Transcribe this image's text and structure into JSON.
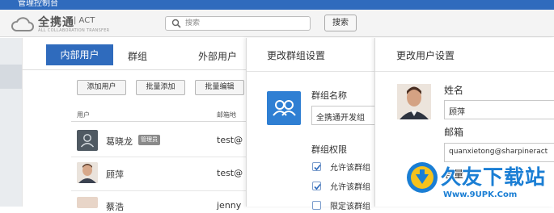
{
  "app": {
    "title": "管理控制台"
  },
  "logo": {
    "main": "全携通",
    "suffix": "| ACT",
    "tagline": "ALL COLLABORATION TRANSFER"
  },
  "search": {
    "placeholder": "搜索",
    "button": "搜索"
  },
  "users_panel": {
    "tabs": [
      {
        "label": "内部用户",
        "active": true
      },
      {
        "label": "群组"
      },
      {
        "label": "外部用户"
      }
    ],
    "toolbar": {
      "add_user": "添加用户",
      "batch_add": "批量添加",
      "batch_edit": "批量编辑"
    },
    "columns": {
      "user": "用户",
      "email": "邮箱地"
    },
    "rows": [
      {
        "name": "葛晓龙",
        "badge": "管理员",
        "email": "test@"
      },
      {
        "name": "顾萍",
        "email": "test@"
      },
      {
        "name": "蔡浩",
        "email": "jenny"
      }
    ]
  },
  "group_panel": {
    "title": "更改群组设置",
    "name_label": "群组名称",
    "name_value": "全携通开发组",
    "perm_label": "群组权限",
    "perms": [
      {
        "label": "允许该群组",
        "checked": true
      },
      {
        "label": "允许该群组",
        "checked": true
      },
      {
        "label": "限定该群组",
        "checked": false
      }
    ]
  },
  "user_panel": {
    "title": "更改用户设置",
    "name_label": "姓名",
    "name_value": "顾萍",
    "email_label": "邮箱",
    "email_value": "quanxietong@sharpineract",
    "capacity_label": "容量"
  },
  "watermark": {
    "text": "久友下载站",
    "url": "Www.9UPK.Com"
  },
  "colors": {
    "accent": "#2f6bbd",
    "group_icon": "#2f7fd3",
    "watermark": "#1a7ed4"
  }
}
